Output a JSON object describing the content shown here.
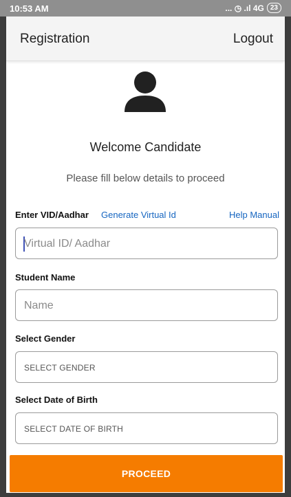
{
  "status_bar": {
    "time": "10:53 AM",
    "indicators": "... ◷ .ıl 4G",
    "battery": "23"
  },
  "app_bar": {
    "title": "Registration",
    "logout_label": "Logout"
  },
  "avatar_icon": "person-icon",
  "welcome": {
    "title": "Welcome Candidate",
    "subtitle": "Please fill below details to proceed"
  },
  "form": {
    "vid": {
      "label": "Enter VID/Aadhar",
      "generate_link": "Generate Virtual Id",
      "help_link": "Help Manual",
      "placeholder": "Virtual ID/ Aadhar"
    },
    "student_name": {
      "label": "Student Name",
      "placeholder": "Name"
    },
    "gender": {
      "label": "Select Gender",
      "placeholder": "SELECT GENDER"
    },
    "dob": {
      "label": "Select Date of Birth",
      "placeholder": "SELECT DATE OF BIRTH"
    }
  },
  "proceed_button": {
    "label": "PROCEED"
  },
  "colors": {
    "accent": "#f57c00",
    "link": "#1565c0",
    "status_bar": "#8f8f8f"
  }
}
